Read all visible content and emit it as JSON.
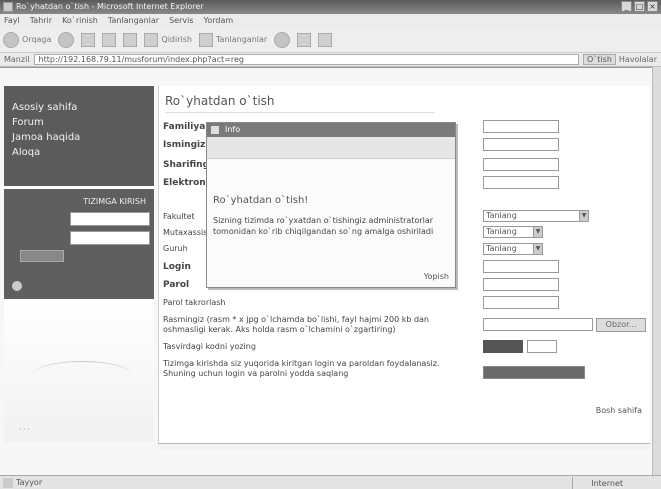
{
  "window": {
    "title": "Ro`yhatdan o`tish - Microsoft Internet Explorer",
    "btns": [
      "_",
      "□",
      "×"
    ]
  },
  "menubar": [
    "Fayl",
    "Tahrir",
    "Ko`rinish",
    "Tanlanganlar",
    "Servis",
    "Yordam"
  ],
  "toolbar": {
    "back": "Orqaga",
    "search": "Qidirish",
    "favorites": "Tanlanganlar"
  },
  "address": {
    "label": "Manzil",
    "url": "http://192.168.79.11/musforum/index.php?act=reg",
    "go": "O`tish",
    "links": "Havolalar"
  },
  "sidebar": {
    "nav": [
      "Asosiy sahifa",
      "Forum",
      "Jamoa haqida",
      "Aloqa"
    ],
    "login_title": "TIZIMGA KIRISH",
    "brand": "..."
  },
  "main": {
    "title": "Ro`yhatdan o`tish",
    "labels": {
      "surname": "Familiyangiz",
      "name": "Ismingiz",
      "patronymic": "Sharifingiz",
      "email": "Elektron",
      "faculty": "Fakultet",
      "course": "Mutaxassislik",
      "group": "Guruh",
      "login": "Login",
      "password": "Parol",
      "password_repeat": "Parol takrorlash",
      "photo": "Rasmingiz (rasm * x jpg o`lchamda bo`lishi, fayl hajmi 200 kb dan oshmasligi kerak. Aks holda rasm o`lchamini o`zgartiring)",
      "captcha": "Tasvirdagi kodni yozing",
      "note": "Tizimga kirishda siz yuqorida kiritgan login va paroldan foydalanasiz. Shuning uchun login va parolni yodda saqlang"
    },
    "selects": {
      "faculty": "Tanlang",
      "course": "Tanlang",
      "group": "Tanlang"
    },
    "browse": "Obzor...",
    "bottom_link": "Bosh sahifa"
  },
  "modal": {
    "head": "Info",
    "title": "Ro`yhatdan o`tish!",
    "body": "Sizning tizimda ro`yxatdan o`tishingiz administratorlar tomonidan ko`rib chiqilgandan so`ng amalga oshiriladi",
    "link": "Yopish"
  },
  "status": {
    "left": "Tayyor",
    "zone": "Internet"
  }
}
